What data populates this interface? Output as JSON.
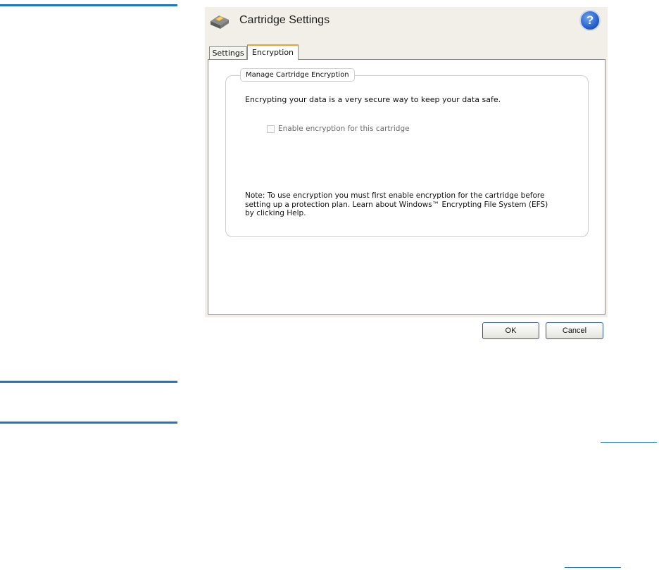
{
  "dialog": {
    "title": "Cartridge Settings",
    "help_label": "?",
    "tabs": [
      {
        "label": "Settings",
        "selected": false
      },
      {
        "label": "Encryption",
        "selected": true
      }
    ],
    "group_title": "Manage Cartridge Encryption",
    "description": "Encrypting your data is a very secure way to keep your data safe.",
    "checkbox": {
      "label": "Enable encryption for this cartridge",
      "checked": false,
      "enabled": false
    },
    "note_lines": [
      "Note: To use encryption you must first enable encryption for the cartridge before",
      "setting up a protection plan. Learn about Windows™ Encrypting File System (EFS)",
      "by clicking Help."
    ],
    "buttons": {
      "ok": "OK",
      "cancel": "Cancel"
    }
  },
  "colors": {
    "accent_rule": "#1d77c2",
    "dialog_bg": "#f1efe7",
    "tab_highlight": "#f0a030",
    "help_blue": "#1d56c4"
  },
  "icons": {
    "title": "cartridge-drive-icon",
    "help": "help-question-icon"
  }
}
